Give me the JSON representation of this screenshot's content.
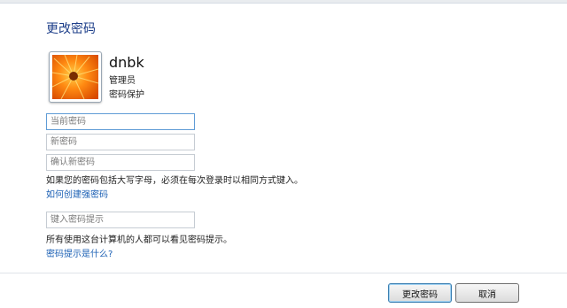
{
  "page": {
    "title": "更改密码"
  },
  "user": {
    "name": "dnbk",
    "role": "管理员",
    "protection": "密码保护"
  },
  "fields": {
    "current_password_placeholder": "当前密码",
    "new_password_placeholder": "新密码",
    "confirm_password_placeholder": "确认新密码",
    "hint_placeholder": "键入密码提示"
  },
  "notes": {
    "caps_note": "如果您的密码包括大写字母，必须在每次登录时以相同方式键入。",
    "strong_password_link": "如何创建强密码",
    "hint_note": "所有使用这台计算机的人都可以看见密码提示。",
    "hint_link": "密码提示是什么?"
  },
  "buttons": {
    "change": "更改密码",
    "cancel": "取消"
  },
  "icons": {
    "avatar": "orange-flower-user-picture"
  },
  "colors": {
    "title": "#1e3f8a",
    "link": "#1a5fb4",
    "focus_border": "#5f9cd6"
  }
}
